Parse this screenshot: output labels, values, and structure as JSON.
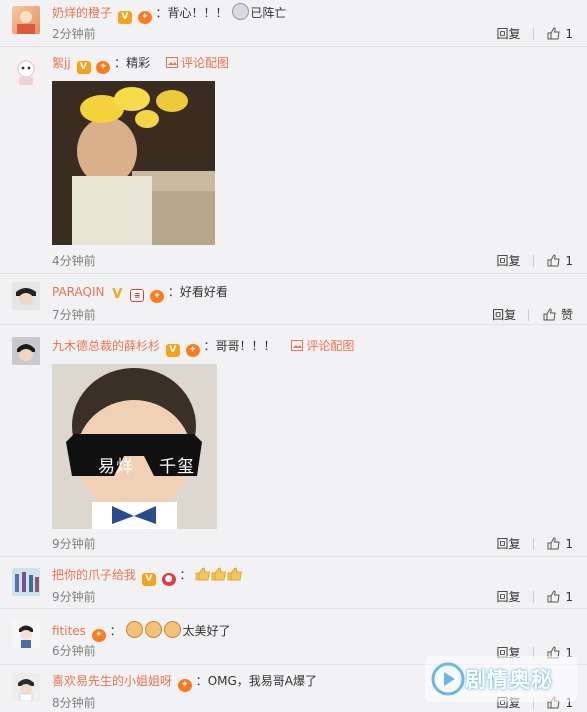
{
  "comments": [
    {
      "username": "奶烊的橙子",
      "text": "背心！！！",
      "emoji_text": "已阵亡",
      "time": "2分钟前",
      "reply_label": "回复",
      "like_count": "1"
    },
    {
      "username": "絮jj",
      "text": "精彩",
      "pic_link": "评论配图",
      "time": "4分钟前",
      "reply_label": "回复",
      "like_count": "1"
    },
    {
      "username": "PARAQIN",
      "text": "好看好看",
      "time": "7分钟前",
      "reply_label": "回复",
      "like_label": "赞"
    },
    {
      "username": "九木德总裁的薛杉杉",
      "text": "哥哥！！！",
      "pic_link": "评论配图",
      "image_caption_left": "易烊",
      "image_caption_right": "千玺",
      "time": "9分钟前",
      "reply_label": "回复",
      "like_count": "1"
    },
    {
      "username": "把你的爪子给我",
      "time": "9分钟前",
      "reply_label": "回复",
      "like_count": "1"
    },
    {
      "username": "fitites",
      "text": "太美好了",
      "time": "6分钟前",
      "reply_label": "回复",
      "like_count": "1"
    },
    {
      "username": "喜欢易先生的小姐姐呀",
      "text": "OMG，我易哥A爆了",
      "time": "8分钟前",
      "reply_label": "回复",
      "like_count": "1"
    }
  ],
  "watermark": {
    "text": "剧情奥秘"
  },
  "colors": {
    "username": "#eb7350",
    "time": "#808080",
    "background": "#f2f2f5"
  }
}
